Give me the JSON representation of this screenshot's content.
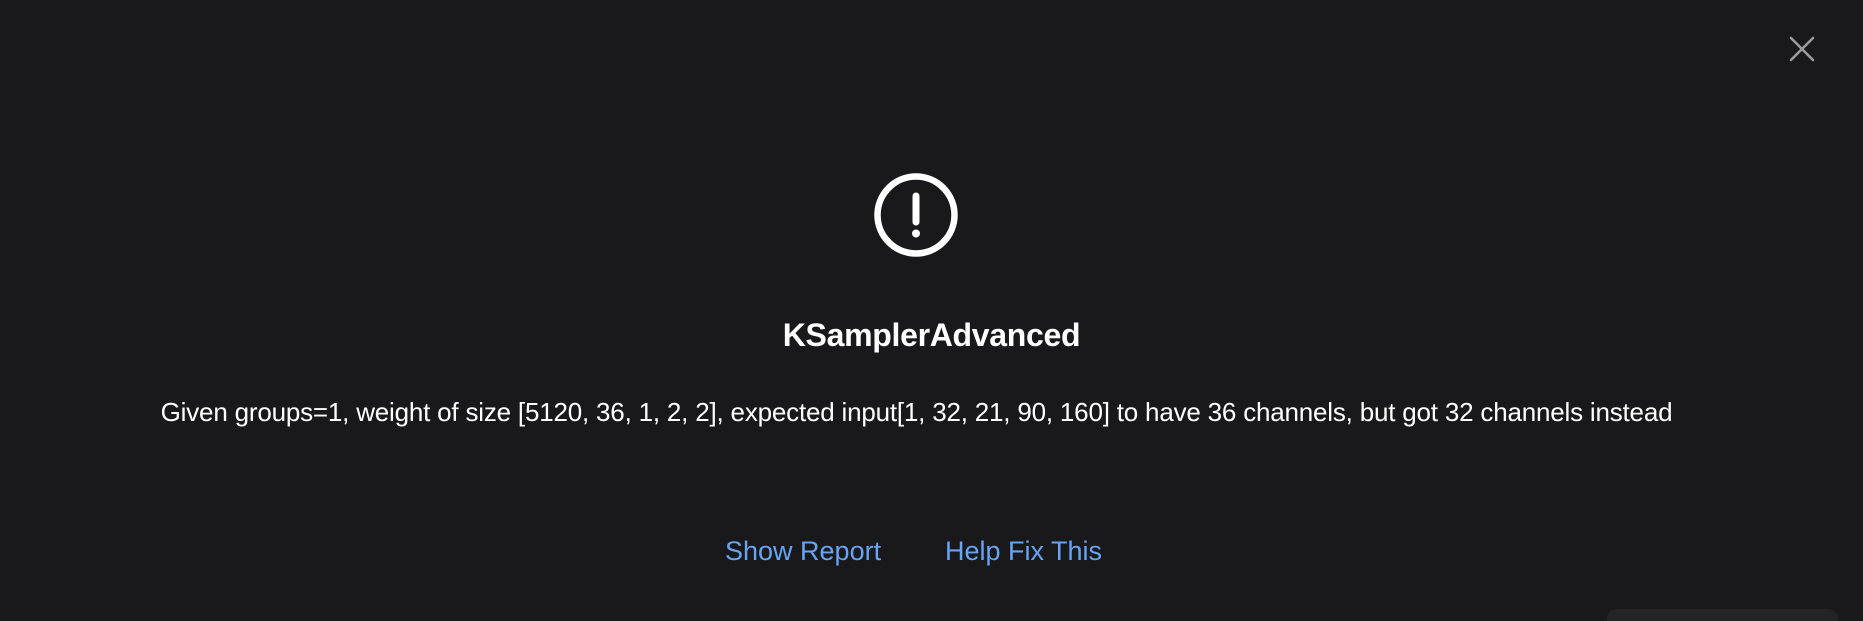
{
  "dialog": {
    "title": "KSamplerAdvanced",
    "message": "Given groups=1, weight of size [5120, 36, 1, 2, 2], expected input[1, 32, 21, 90, 160] to have 36 channels, but got 32 channels instead",
    "actions": {
      "show_report_label": "Show Report",
      "help_fix_label": "Help Fix This"
    },
    "icons": {
      "status": "exclamation-circle-icon",
      "close": "close-icon"
    }
  },
  "colors": {
    "background": "#19191b",
    "text": "#ffffff",
    "link": "#67a4f2",
    "close_icon": "#9a9aa0"
  }
}
